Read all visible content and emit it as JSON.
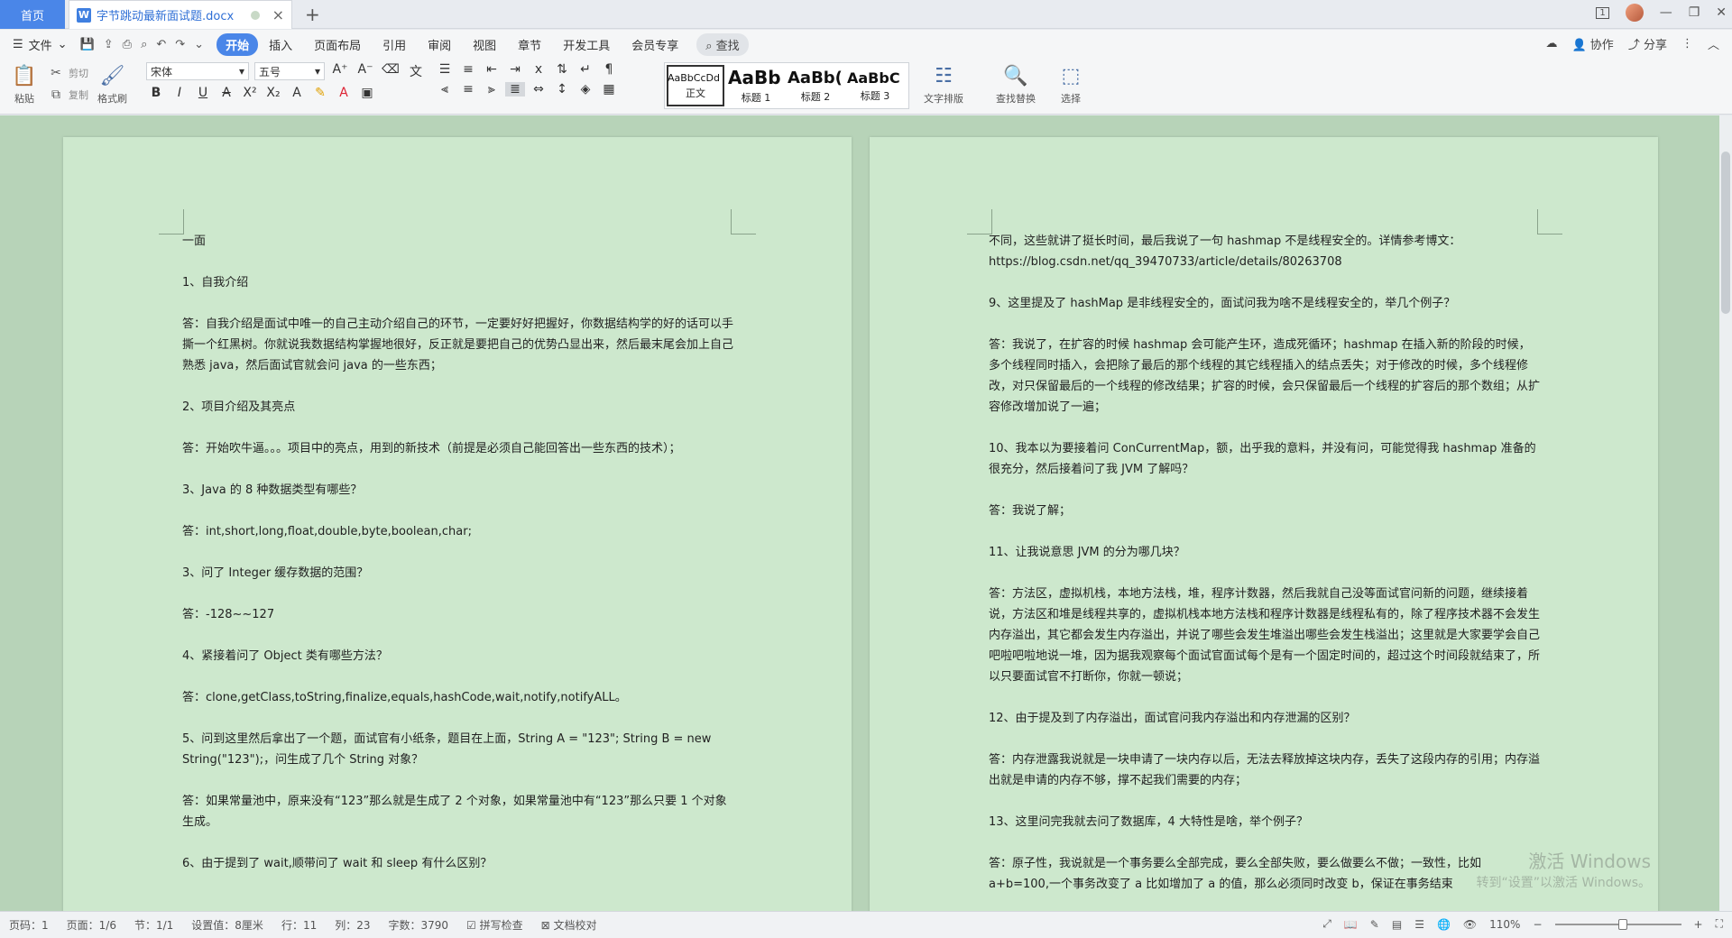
{
  "tabs": {
    "home": "首页",
    "doc_name": "字节跳动最新面试题.docx",
    "doc_icon_letter": "W",
    "add": "+",
    "close": "×",
    "page_badge": "1"
  },
  "menu": {
    "file_label": "文件",
    "items": [
      "开始",
      "插入",
      "页面布局",
      "引用",
      "审阅",
      "视图",
      "章节",
      "开发工具",
      "会员专享"
    ],
    "search_label": "查找",
    "right": [
      "协作",
      "分享"
    ]
  },
  "ribbon": {
    "paste": "粘贴",
    "cut": "剪切",
    "copy": "复制",
    "format_painter": "格式刷",
    "font_name": "宋体",
    "font_size": "五号",
    "styles": [
      {
        "sample": "AaBbCcDd",
        "name": "正文"
      },
      {
        "sample": "AaBb",
        "name": "标题 1"
      },
      {
        "sample": "AaBb(",
        "name": "标题 2"
      },
      {
        "sample": "AaBbC",
        "name": "标题 3"
      }
    ],
    "text_layout": "文字排版",
    "find_replace": "查找替换",
    "select": "选择"
  },
  "document": {
    "left_page": [
      "一面",
      "1、自我介绍",
      "答：自我介绍是面试中唯一的自己主动介绍自己的环节，一定要好好把握好，你数据结构学的好的话可以手撕一个红黑树。你就说我数据结构掌握地很好，反正就是要把自己的优势凸显出来，然后最末尾会加上自己熟悉 java，然后面试官就会问 java 的一些东西；",
      "2、项目介绍及其亮点",
      "答：开始吹牛逼。。。项目中的亮点，用到的新技术（前提是必须自己能回答出一些东西的技术）；",
      "3、Java 的 8 种数据类型有哪些？",
      "答：int,short,long,float,double,byte,boolean,char;",
      "3、问了 Integer 缓存数据的范围？",
      "答：-128~~127",
      "4、紧接着问了 Object 类有哪些方法？",
      "答：clone,getClass,toString,finalize,equals,hashCode,wait,notify,notifyALL。",
      "5、问到这里然后拿出了一个题，面试官有小纸条，题目在上面，String A = \"123\"; String B = new String(\"123\");，问生成了几个 String 对象？",
      "答：如果常量池中，原来没有“123”那么就是生成了 2 个对象，如果常量池中有“123”那么只要 1 个对象生成。",
      "6、由于提到了 wait,顺带问了 wait 和 sleep 有什么区别？"
    ],
    "right_page": [
      "不同，这些就讲了挺长时间，最后我说了一句 hashmap 不是线程安全的。详情参考博文：https://blog.csdn.net/qq_39470733/article/details/80263708",
      "9、这里提及了 hashMap 是非线程安全的，面试问我为啥不是线程安全的，举几个例子？",
      "答：我说了，在扩容的时候 hashmap 会可能产生环，造成死循环；hashmap 在插入新的阶段的时候，多个线程同时插入，会把除了最后的那个线程的其它线程插入的结点丢失；对于修改的时候，多个线程修改，对只保留最后的一个线程的修改结果；扩容的时候，会只保留最后一个线程的扩容后的那个数组；从扩容修改增加说了一遍；",
      "10、我本以为要接着问 ConCurrentMap，额，出乎我的意料，并没有问，可能觉得我 hashmap 准备的很充分，然后接着问了我 JVM 了解吗？",
      "答：我说了解；",
      "11、让我说意思 JVM 的分为哪几块？",
      "答：方法区，虚拟机栈，本地方法栈，堆，程序计数器，然后我就自己没等面试官问新的问题，继续接着说，方法区和堆是线程共享的，虚拟机栈本地方法栈和程序计数器是线程私有的，除了程序技术器不会发生内存溢出，其它都会发生内存溢出，并说了哪些会发生堆溢出哪些会发生栈溢出；这里就是大家要学会自己吧啦吧啦地说一堆，因为据我观察每个面试官面试每个是有一个固定时间的，超过这个时间段就结束了，所以只要面试官不打断你，你就一顿说；",
      "12、由于提及到了内存溢出，面试官问我内存溢出和内存泄漏的区别？",
      "答：内存泄露我说就是一块申请了一块内存以后，无法去释放掉这块内存，丢失了这段内存的引用；内存溢出就是申请的内存不够，撑不起我们需要的内存；",
      "13、这里问完我就去问了数据库，4 大特性是啥，举个例子？",
      "答：原子性，我说就是一个事务要么全部完成，要么全部失败，要么做要么不做；一致性，比如 a+b=100,一个事务改变了 a 比如增加了 a 的值，那么必须同时改变 b，保证在事务结束"
    ],
    "watermark": "激活 Windows",
    "watermark_sub": "转到“设置”以激活 Windows。"
  },
  "status": {
    "page_code": "页码：1",
    "page_count": "页面：1/6",
    "section": "节：1/1",
    "position": "设置值：8厘米",
    "row": "行：11",
    "col": "列：23",
    "word_count": "字数：3790",
    "spell_check": "拼写检查",
    "doc_proof": "文档校对",
    "zoom": "110%"
  }
}
